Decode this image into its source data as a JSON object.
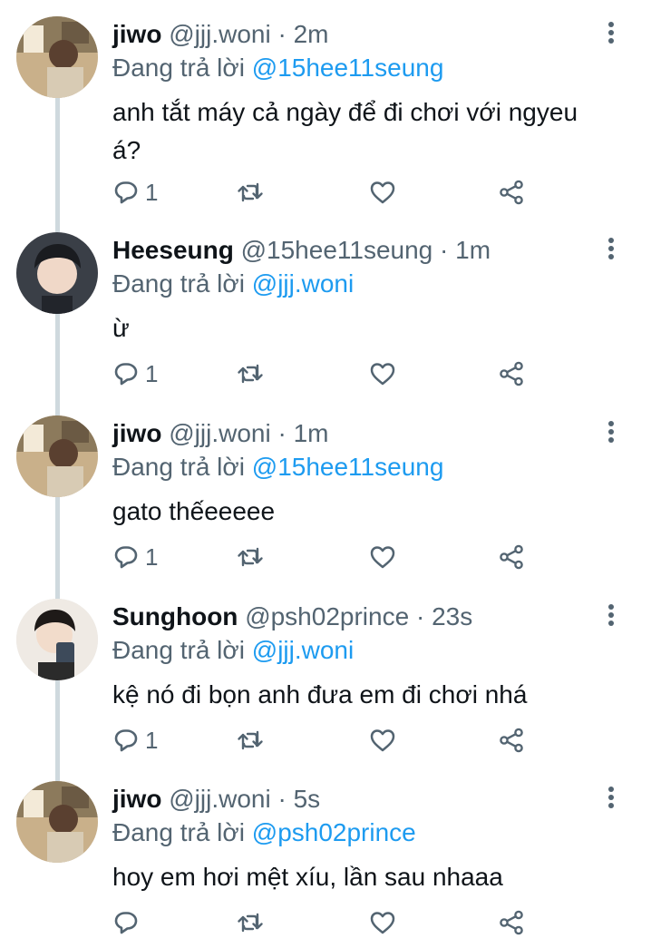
{
  "reply_prefix": "Đang trả lời",
  "tweets": [
    {
      "name": "jiwo",
      "handle": "@jjj.woni",
      "dot": "·",
      "time": "2m",
      "reply_to": "@15hee11seung",
      "text": "anh tắt máy cả ngày để đi chơi với ngyeu á?",
      "reply_count": "1",
      "avatar": "jiwo"
    },
    {
      "name": "Heeseung",
      "handle": "@15hee11seung",
      "dot": "·",
      "time": "1m",
      "reply_to": "@jjj.woni",
      "text": "ừ",
      "reply_count": "1",
      "avatar": "heeseung"
    },
    {
      "name": "jiwo",
      "handle": "@jjj.woni",
      "dot": "·",
      "time": "1m",
      "reply_to": "@15hee11seung",
      "text": "gato thếeeeee",
      "reply_count": "1",
      "avatar": "jiwo"
    },
    {
      "name": "Sunghoon",
      "handle": "@psh02prince",
      "dot": "·",
      "time": "23s",
      "reply_to": "@jjj.woni",
      "text": "kệ nó đi bọn anh đưa em đi chơi nhá",
      "reply_count": "1",
      "avatar": "sunghoon"
    },
    {
      "name": "jiwo",
      "handle": "@jjj.woni",
      "dot": "·",
      "time": "5s",
      "reply_to": "@psh02prince",
      "text": "hoy em hơi mệt xíu, lần sau nhaaa",
      "reply_count": "",
      "avatar": "jiwo"
    }
  ],
  "colors": {
    "accent": "#1d9bf0",
    "muted": "#536471",
    "text": "#0f1419",
    "thread_line": "#cfd9de"
  }
}
